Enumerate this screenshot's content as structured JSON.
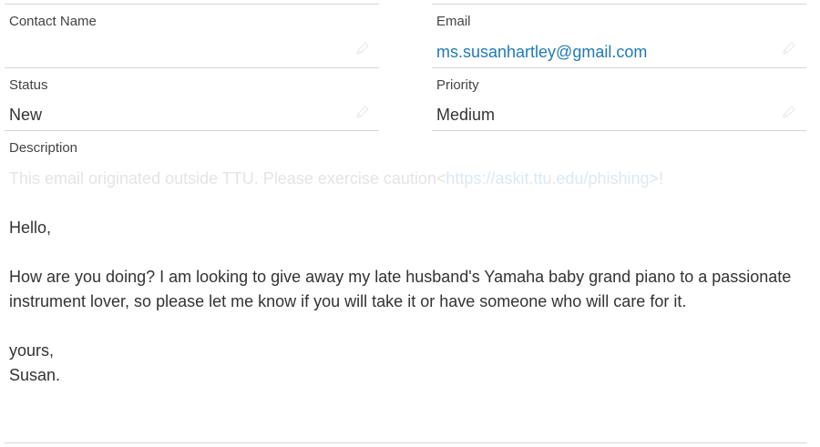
{
  "fields": {
    "contact_name": {
      "label": "Contact Name",
      "value": ""
    },
    "email": {
      "label": "Email",
      "value": "ms.susanhartley@gmail.com"
    },
    "status": {
      "label": "Status",
      "value": "New"
    },
    "priority": {
      "label": "Priority",
      "value": "Medium"
    }
  },
  "description": {
    "label": "Description",
    "warning_text": "This email originated outside TTU. Please exercise caution<",
    "warning_link": "https://askit.ttu.edu/phishing>",
    "warning_tail": "!",
    "paragraphs": [
      "Hello,",
      "How are you doing? I am looking to give away my late husband's Yamaha baby grand piano to a passionate instrument lover, so please let me know if you will take it or have someone who will care for it.",
      "yours,"
    ],
    "signature": "Susan."
  },
  "colors": {
    "link": "#1f7ab5",
    "divider": "#d6d6d6",
    "text": "#333333",
    "faint_warning": "#e4e4e4"
  },
  "icons": {
    "edit": "pencil-icon"
  }
}
